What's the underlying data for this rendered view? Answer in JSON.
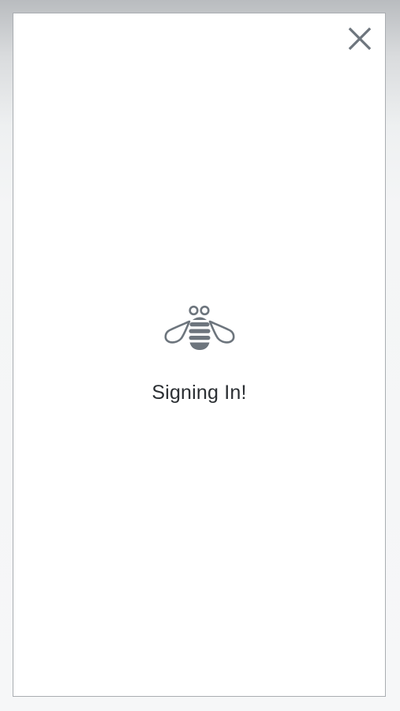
{
  "dialog": {
    "close_icon": "close-icon",
    "loading_icon": "bee-icon",
    "status_text": "Signing In!"
  },
  "colors": {
    "icon": "#6d757d",
    "text": "#2b2f33",
    "modal_background": "#ffffff",
    "modal_border": "#a9adb1"
  }
}
